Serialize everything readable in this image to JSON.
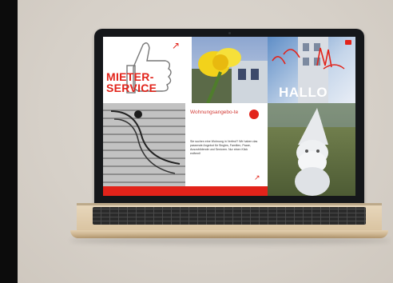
{
  "screen": {
    "tiles": {
      "mieter": {
        "line1": "MIETER-",
        "line2": "SERVICE"
      },
      "hallo": {
        "text": "HALLO"
      },
      "wohnung": {
        "title": "Wohnungsangebo-te",
        "body": "Sie suchen eine Wohnung in Verfeuf? Wir haben das passende Angebot für Singles, Familien, Paare, Auszubildende und Senioren. Nur einen Klick entfernt!"
      }
    },
    "arrow_glyph": "↗"
  },
  "colors": {
    "brand_red": "#e2231a",
    "background": "#d6d0c8",
    "laptop_gold": "#e0cbaa"
  }
}
